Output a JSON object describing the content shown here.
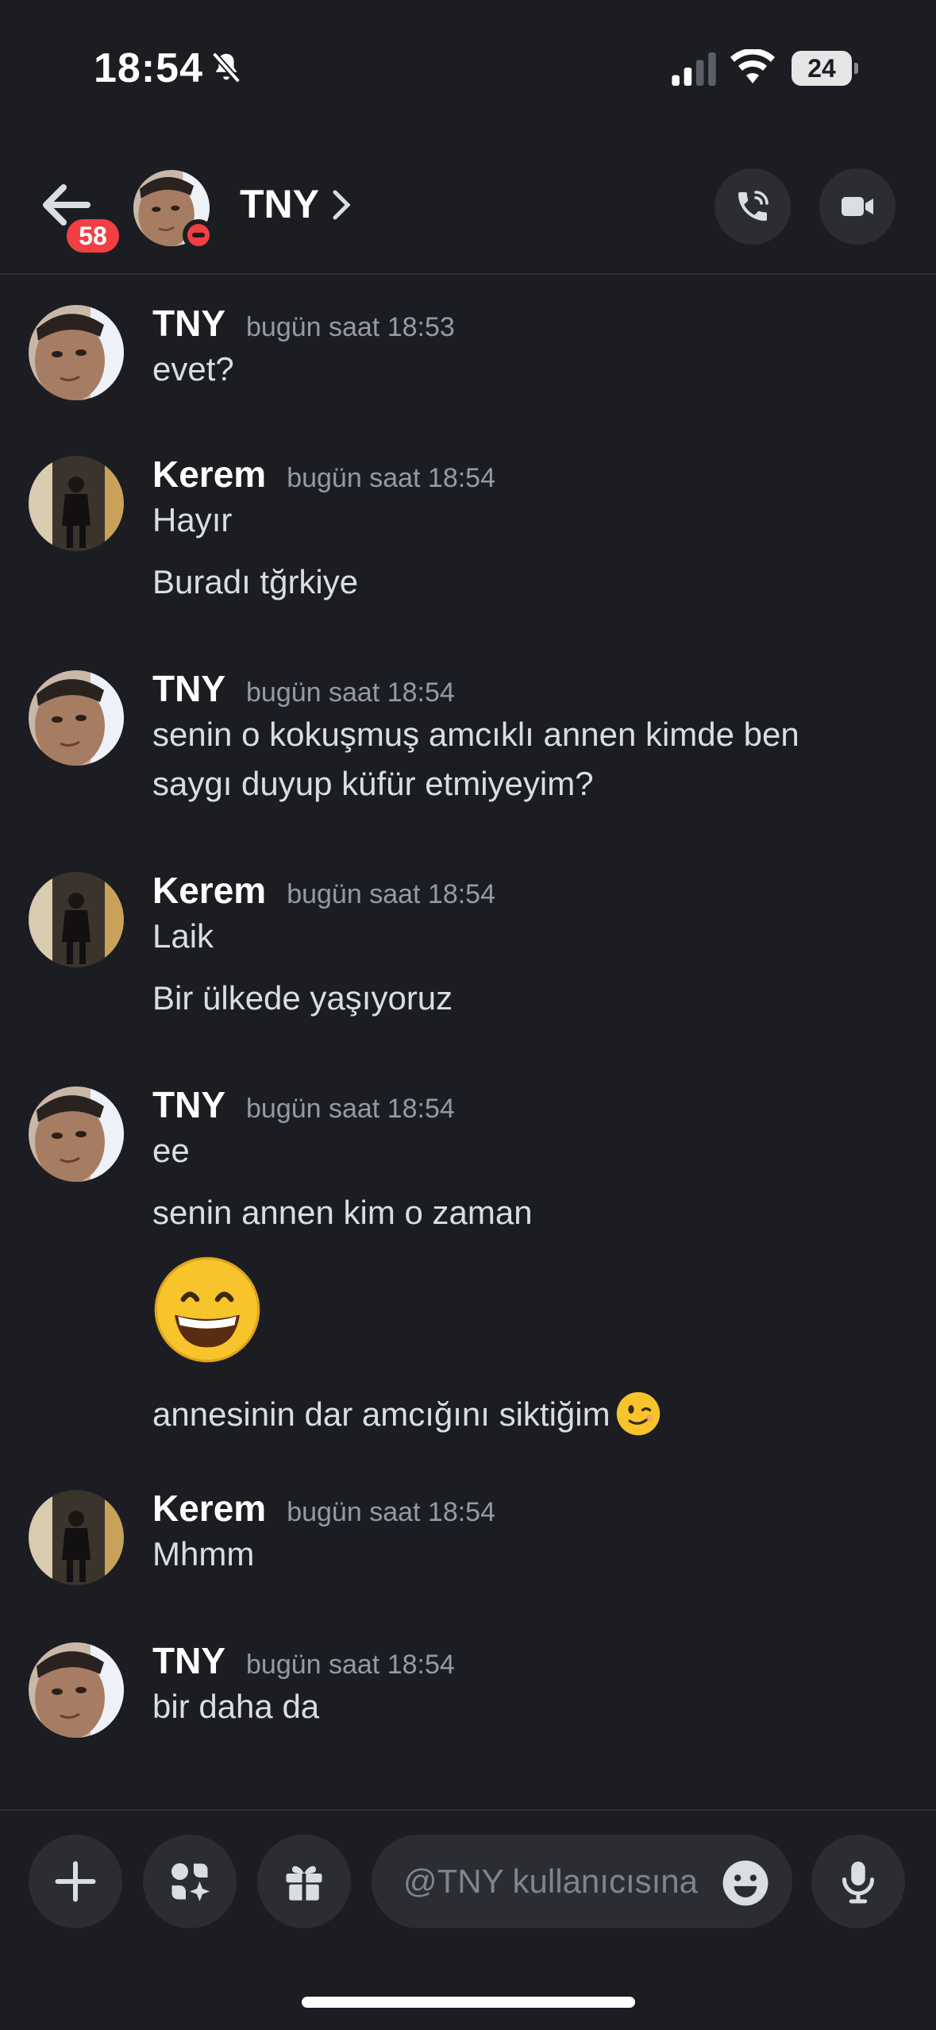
{
  "status_bar": {
    "time": "18:54",
    "battery": "24"
  },
  "header": {
    "back_badge": "58",
    "contact_name": "TNY"
  },
  "messages": [
    {
      "author": "TNY",
      "timestamp": "bugün saat 18:53",
      "lines": [
        "evet?"
      ]
    },
    {
      "author": "Kerem",
      "timestamp": "bugün saat 18:54",
      "lines": [
        "Hayır",
        "Buradı tğrkiye"
      ]
    },
    {
      "author": "TNY",
      "timestamp": "bugün saat 18:54",
      "lines": [
        "senin o kokuşmuş amcıklı annen kimde ben",
        "saygı duyup küfür etmiyeyim?"
      ]
    },
    {
      "author": "Kerem",
      "timestamp": "bugün saat 18:54",
      "lines": [
        "Laik",
        "Bir ülkede yaşıyoruz"
      ]
    },
    {
      "author": "TNY",
      "timestamp": "bugün saat 18:54",
      "lines": [
        "ee",
        "senin annen kim o zaman",
        "annesinin dar amcığını siktiğim"
      ],
      "big_emoji": "grinning-face-emoji",
      "inline_emoji": "winking-face-emoji"
    },
    {
      "author": "Kerem",
      "timestamp": "bugün saat 18:54",
      "lines": [
        "Mhmm"
      ]
    },
    {
      "author": "TNY",
      "timestamp": "bugün saat 18:54",
      "lines": [
        "bir daha da"
      ]
    }
  ],
  "composer": {
    "placeholder": "@TNY kullanıcısına"
  },
  "colors": {
    "background": "#1c1d23",
    "badge_red": "#f23f43",
    "timestamp_gray": "#949ba4",
    "button_bg": "#2b2d33"
  }
}
